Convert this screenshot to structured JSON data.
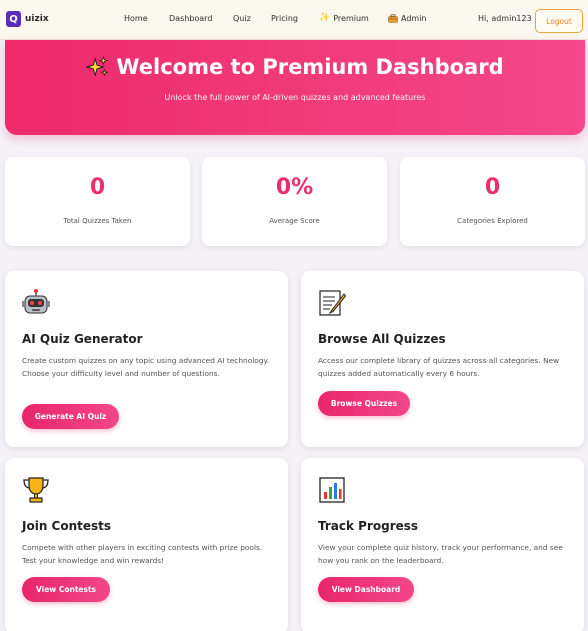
{
  "brand": {
    "mark": "Q",
    "name": "uizix"
  },
  "nav": {
    "home": "Home",
    "dashboard": "Dashboard",
    "quiz": "Quiz",
    "pricing": "Pricing",
    "premium": "Premium",
    "admin": "Admin",
    "greeting": "Hi, admin123",
    "logout": "Logout"
  },
  "hero": {
    "title": "Welcome to Premium Dashboard",
    "subtitle": "Unlock the full power of AI-driven quizzes and advanced features"
  },
  "stats": [
    {
      "value": "0",
      "label": "Total Quizzes Taken"
    },
    {
      "value": "0%",
      "label": "Average Score"
    },
    {
      "value": "0",
      "label": "Categories Explored"
    }
  ],
  "cards": [
    {
      "icon": "robot-icon",
      "title": "AI Quiz Generator",
      "description": "Create custom quizzes on any topic using advanced AI technology. Choose your difficulty level and number of questions.",
      "button": "Generate AI Quiz"
    },
    {
      "icon": "memo-icon",
      "title": "Browse All Quizzes",
      "description": "Access our complete library of quizzes across all categories. New quizzes added automatically every 6 hours.",
      "button": "Browse Quizzes"
    },
    {
      "icon": "trophy-icon",
      "title": "Join Contests",
      "description": "Compete with other players in exciting contests with prize pools. Test your knowledge and win rewards!",
      "button": "View Contests"
    },
    {
      "icon": "chart-icon",
      "title": "Track Progress",
      "description": "View your complete quiz history, track your performance, and see how you rank on the leaderboard.",
      "button": "View Dashboard"
    }
  ],
  "colors": {
    "accent": "#ea2f6f",
    "brand": "#5b2fb8",
    "logout": "#e3871c"
  }
}
